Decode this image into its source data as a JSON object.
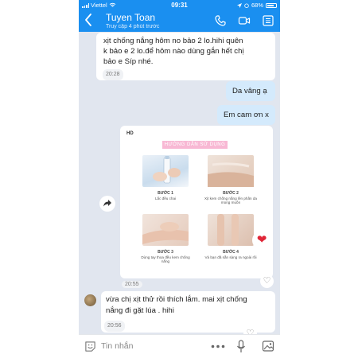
{
  "status_bar": {
    "carrier": "Viettel",
    "time": "09:31",
    "battery": "68%"
  },
  "header": {
    "contact_name": "Tuyen Toan",
    "contact_status": "Truy cập 4 phút trước"
  },
  "messages": [
    {
      "text_lines": [
        "xịt chống nắng hôm no bảo 2 lo.hihi quên",
        "k bảo e 2 lo.để hôm nào dùng gắn hết chị",
        "bảo e Síp nhé."
      ],
      "time": "20:28"
    },
    {
      "text": "Da vâng ạ"
    },
    {
      "text": "Em cam ơn x"
    },
    {
      "time": "20:55"
    },
    {
      "text_lines": [
        "vừa chị xịt thử rồi thích lắm. mai xịt chống",
        "nắng đi gặt lúa . hihi"
      ],
      "time": "20:56"
    }
  ],
  "image": {
    "badge": "HD",
    "title": "HƯỚNG DẪN SỬ DỤNG",
    "steps": [
      {
        "label": "BƯỚC 1",
        "desc": "Lắc đều chai"
      },
      {
        "label": "BƯỚC 2",
        "desc": "Xịt kem chống nắng lên phần da mong muốn"
      },
      {
        "label": "BƯỚC 3",
        "desc": "Dùng tay thoa đều kem chống nắng"
      },
      {
        "label": "BƯỚC 4",
        "desc": "Và bạn đã sẵn sàng ra ngoài rồi"
      }
    ]
  },
  "composer": {
    "placeholder": "Tin nhắn"
  },
  "icons": {
    "back": "chevron-left-icon",
    "call": "phone-icon",
    "video": "video-camera-icon",
    "info": "list-info-icon",
    "share": "share-arrow-icon",
    "heart": "heart-icon",
    "like": "heart-outline-icon",
    "sticker": "sticker-smile-icon",
    "more": "more-dots-icon",
    "mic": "microphone-icon",
    "gallery": "image-gallery-icon"
  },
  "colors": {
    "brand": "#1a8ff0",
    "outgoing_bubble": "#d4eafc",
    "chat_bg": "#e1e6ef",
    "heart": "#e02638"
  }
}
